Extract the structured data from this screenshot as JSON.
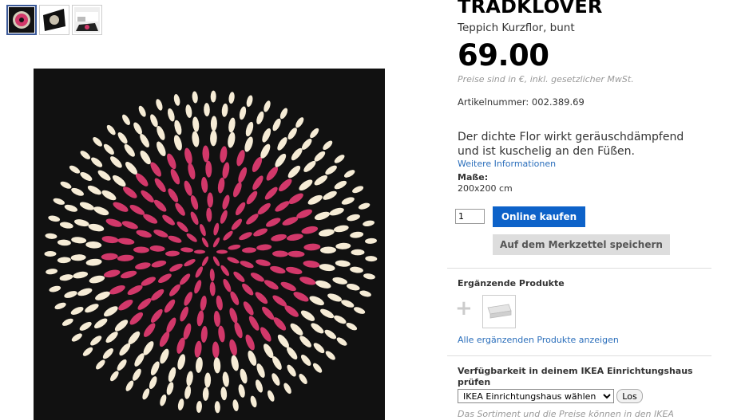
{
  "gallery": {
    "thumbnails": [
      {
        "name": "rug-front-view",
        "active": true
      },
      {
        "name": "rug-angled-view",
        "active": false
      },
      {
        "name": "rug-room-view",
        "active": false
      }
    ],
    "main_image": "rug-traedkloever"
  },
  "product": {
    "title": "TRÄDKLÖVER",
    "subtitle": "Teppich Kurzflor, bunt",
    "price": "69.00",
    "price_note": "Preise sind in €, inkl. gesetzlicher MwSt.",
    "article_number": "Artikelnummer: 002.389.69",
    "description": "Der dichte Flor wirkt geräuschdämpfend und ist kuschelig an den Füßen.",
    "more_info_link": "Weitere Informationen",
    "dimensions_label": "Maße:",
    "dimensions_value": "200x200 cm"
  },
  "purchase": {
    "quantity": "1",
    "buy_label": "Online kaufen",
    "save_label": "Auf dem Merkzettel speichern"
  },
  "complementary": {
    "title": "Ergänzende Produkte",
    "plus_symbol": "+",
    "show_all_link": "Alle ergänzenden Produkte anzeigen"
  },
  "availability": {
    "title": "Verfügbarkeit in deinem IKEA Einrichtungshaus prüfen",
    "select_value": "IKEA Einrichtungshaus wählen",
    "go_label": "Los",
    "note": "Das Sortiment und die Preise können in den IKEA"
  },
  "colors": {
    "brand_blue": "#0d62c9",
    "link_blue": "#2a6ebb",
    "rug_black": "#111111",
    "rug_pink": "#d2386a",
    "rug_cream": "#f6ecd6"
  }
}
